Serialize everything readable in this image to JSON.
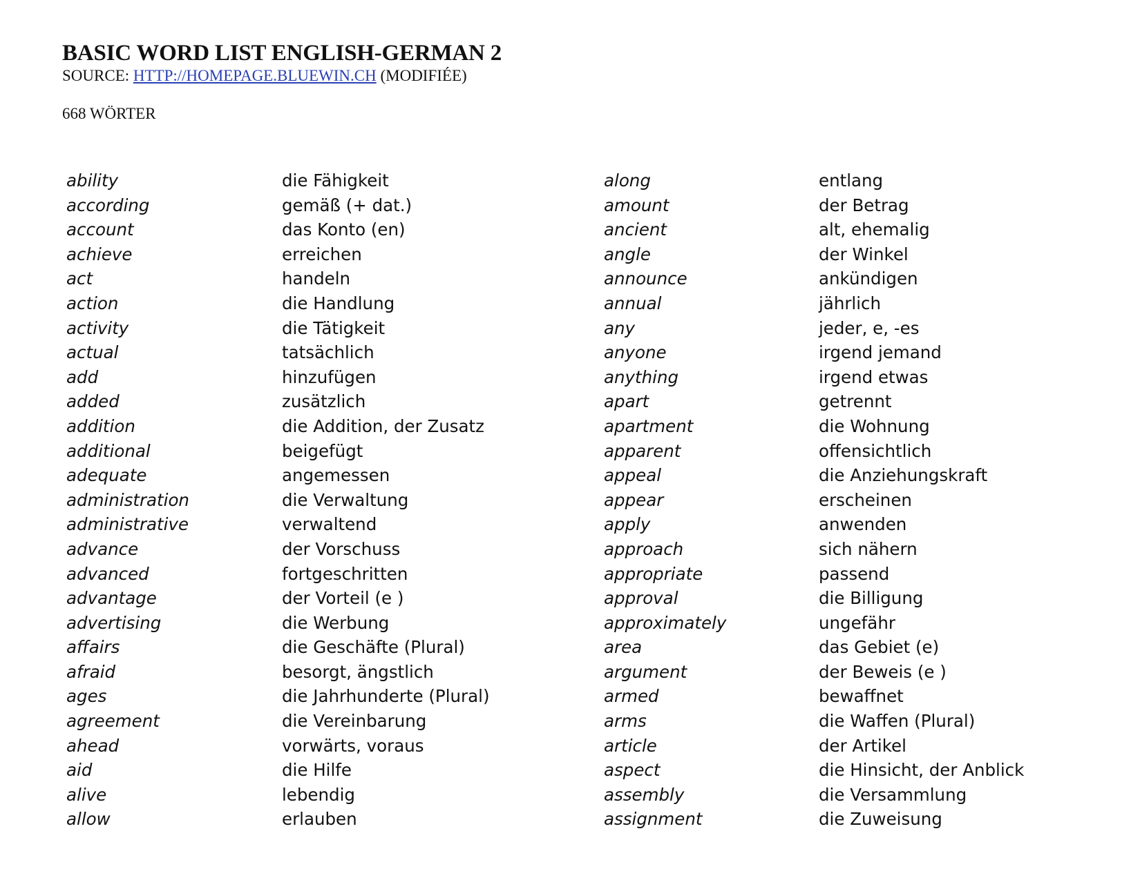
{
  "header": {
    "title": "BASIC WORD LIST ENGLISH-GERMAN 2",
    "source_prefix": "SOURCE: ",
    "source_link": "HTTP://HOMEPAGE.BLUEWIN.CH",
    "source_suffix": " (MODIFIÉE)",
    "word_count": "668 WÖRTER"
  },
  "link_color": "#2a3fb5",
  "columns": [
    {
      "entries": [
        {
          "en": "ability",
          "de": "die Fähigkeit"
        },
        {
          "en": "according",
          "de": "gemäß (+ dat.)"
        },
        {
          "en": "account",
          "de": "das Konto (en)"
        },
        {
          "en": "achieve",
          "de": "erreichen"
        },
        {
          "en": "act",
          "de": "handeln"
        },
        {
          "en": "action",
          "de": "die Handlung"
        },
        {
          "en": "activity",
          "de": "die Tätigkeit"
        },
        {
          "en": "actual",
          "de": "tatsächlich"
        },
        {
          "en": "add",
          "de": "hinzufügen"
        },
        {
          "en": "added",
          "de": "zusätzlich"
        },
        {
          "en": "addition",
          "de": "die Addition, der Zusatz"
        },
        {
          "en": "additional",
          "de": "beigefügt"
        },
        {
          "en": "adequate",
          "de": "angemessen"
        },
        {
          "en": "administration",
          "de": "die Verwaltung"
        },
        {
          "en": "administrative",
          "de": "verwaltend"
        },
        {
          "en": "advance",
          "de": "der Vorschuss"
        },
        {
          "en": "advanced",
          "de": "fortgeschritten"
        },
        {
          "en": "advantage",
          "de": "der Vorteil (e )"
        },
        {
          "en": "advertising",
          "de": "die Werbung"
        },
        {
          "en": "affairs",
          "de": "die Geschäfte (Plural)"
        },
        {
          "en": "afraid",
          "de": "besorgt, ängstlich"
        },
        {
          "en": "ages",
          "de": "die Jahrhunderte (Plural)"
        },
        {
          "en": "agreement",
          "de": "die Vereinbarung"
        },
        {
          "en": "ahead",
          "de": "vorwärts, voraus"
        },
        {
          "en": "aid",
          "de": "die Hilfe"
        },
        {
          "en": "alive",
          "de": "lebendig"
        },
        {
          "en": "allow",
          "de": "erlauben"
        }
      ]
    },
    {
      "entries": [
        {
          "en": "along",
          "de": "entlang"
        },
        {
          "en": "amount",
          "de": "der Betrag"
        },
        {
          "en": "ancient",
          "de": "alt, ehemalig"
        },
        {
          "en": "angle",
          "de": "der Winkel"
        },
        {
          "en": "announce",
          "de": "ankündigen"
        },
        {
          "en": "annual",
          "de": "jährlich"
        },
        {
          "en": "any",
          "de": "jeder, e, -es"
        },
        {
          "en": "anyone",
          "de": "irgend jemand"
        },
        {
          "en": "anything",
          "de": "irgend etwas"
        },
        {
          "en": "apart",
          "de": "getrennt"
        },
        {
          "en": "apartment",
          "de": "die Wohnung"
        },
        {
          "en": "apparent",
          "de": "offensichtlich"
        },
        {
          "en": "appeal",
          "de": "die Anziehungskraft"
        },
        {
          "en": "appear",
          "de": "erscheinen"
        },
        {
          "en": "apply",
          "de": "anwenden"
        },
        {
          "en": "approach",
          "de": "sich nähern"
        },
        {
          "en": "appropriate",
          "de": "passend"
        },
        {
          "en": "approval",
          "de": "die Billigung"
        },
        {
          "en": "approximately",
          "de": "ungefähr"
        },
        {
          "en": "area",
          "de": "das Gebiet (e)"
        },
        {
          "en": "argument",
          "de": "der Beweis (e )"
        },
        {
          "en": "armed",
          "de": "bewaffnet"
        },
        {
          "en": "arms",
          "de": "die Waffen (Plural)"
        },
        {
          "en": "article",
          "de": "der Artikel"
        },
        {
          "en": "aspect",
          "de": "die Hinsicht, der Anblick"
        },
        {
          "en": "assembly",
          "de": "die Versammlung"
        },
        {
          "en": "assignment",
          "de": "die Zuweisung"
        }
      ]
    }
  ]
}
